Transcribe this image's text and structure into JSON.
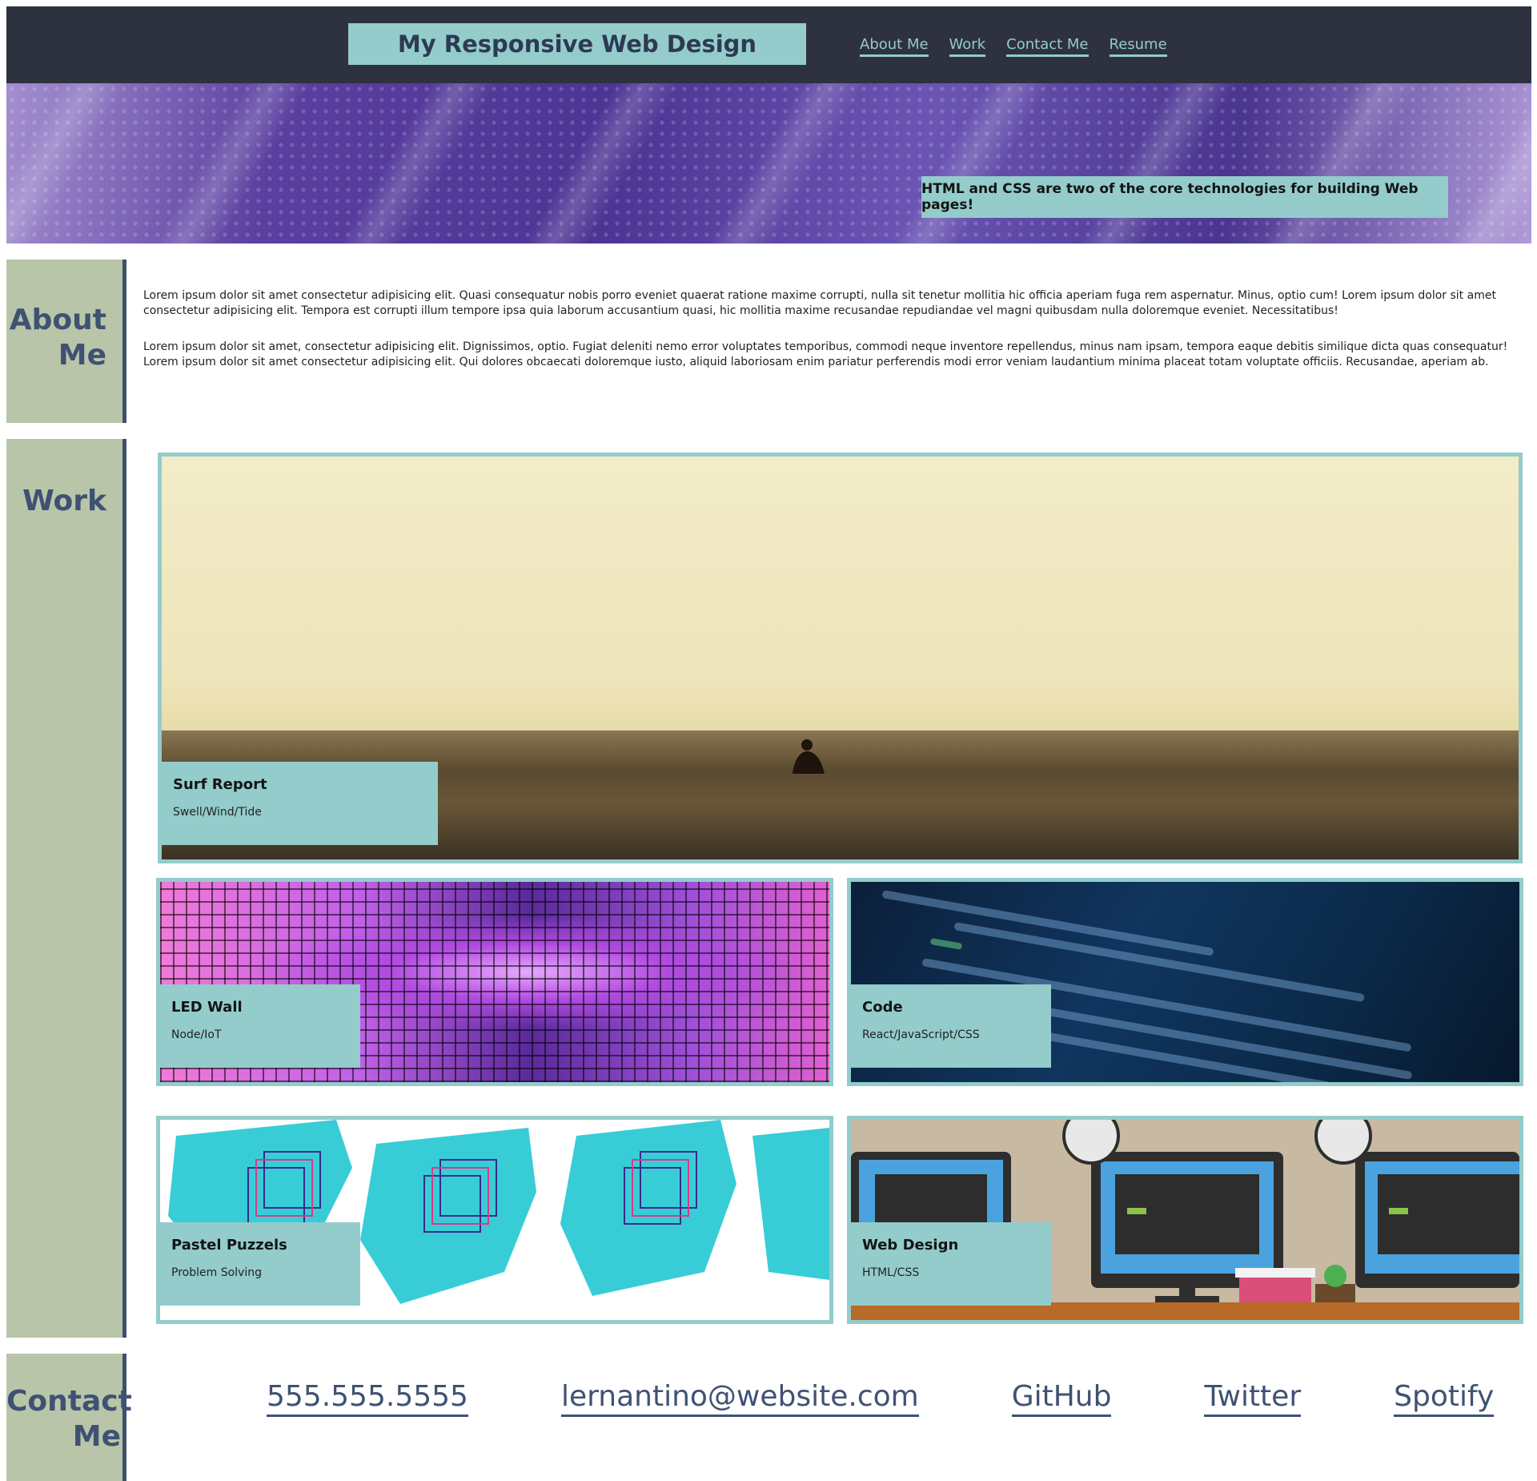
{
  "header": {
    "title": "My Responsive Web Design",
    "nav": [
      "About Me",
      "Work",
      "Contact Me",
      "Resume"
    ]
  },
  "hero": {
    "caption": "HTML and CSS are two of the core technologies for building Web pages!"
  },
  "about": {
    "heading_line1": "About",
    "heading_line2": "Me",
    "paragraphs": [
      "Lorem ipsum dolor sit amet consectetur adipisicing elit. Quasi consequatur nobis porro eveniet quaerat ratione maxime corrupti, nulla sit tenetur mollitia hic officia aperiam fuga rem aspernatur. Minus, optio cum! Lorem ipsum dolor sit amet consectetur adipisicing elit. Tempora est corrupti illum tempore ipsa quia laborum accusantium quasi, hic mollitia maxime recusandae repudiandae vel magni quibusdam nulla doloremque eveniet. Necessitatibus!",
      "Lorem ipsum dolor sit amet, consectetur adipisicing elit. Dignissimos, optio. Fugiat deleniti nemo error voluptates temporibus, commodi neque inventore repellendus, minus nam ipsam, tempora eaque debitis similique dicta quas consequatur! Lorem ipsum dolor sit amet consectetur adipisicing elit. Qui dolores obcaecati doloremque iusto, aliquid laboriosam enim pariatur perferendis modi error veniam laudantium minima placeat totam voluptate officiis. Recusandae, aperiam ab."
    ]
  },
  "work": {
    "heading": "Work",
    "projects": [
      {
        "title": "Surf Report",
        "subtitle": "Swell/Wind/Tide"
      },
      {
        "title": "LED Wall",
        "subtitle": "Node/IoT"
      },
      {
        "title": "Code",
        "subtitle": "React/JavaScript/CSS"
      },
      {
        "title": "Pastel Puzzels",
        "subtitle": "Problem Solving"
      },
      {
        "title": "Web Design",
        "subtitle": "HTML/CSS"
      }
    ]
  },
  "contact": {
    "heading_line1": "Contact",
    "heading_line2": "Me",
    "links": [
      "555.555.5555",
      "lernantino@website.com",
      "GitHub",
      "Twitter",
      "Spotify"
    ]
  },
  "colors": {
    "header_bg": "#2e323e",
    "accent_teal": "#93cccb",
    "sidebar_sage": "#b8c5a8",
    "heading_navy": "#3f5274"
  }
}
